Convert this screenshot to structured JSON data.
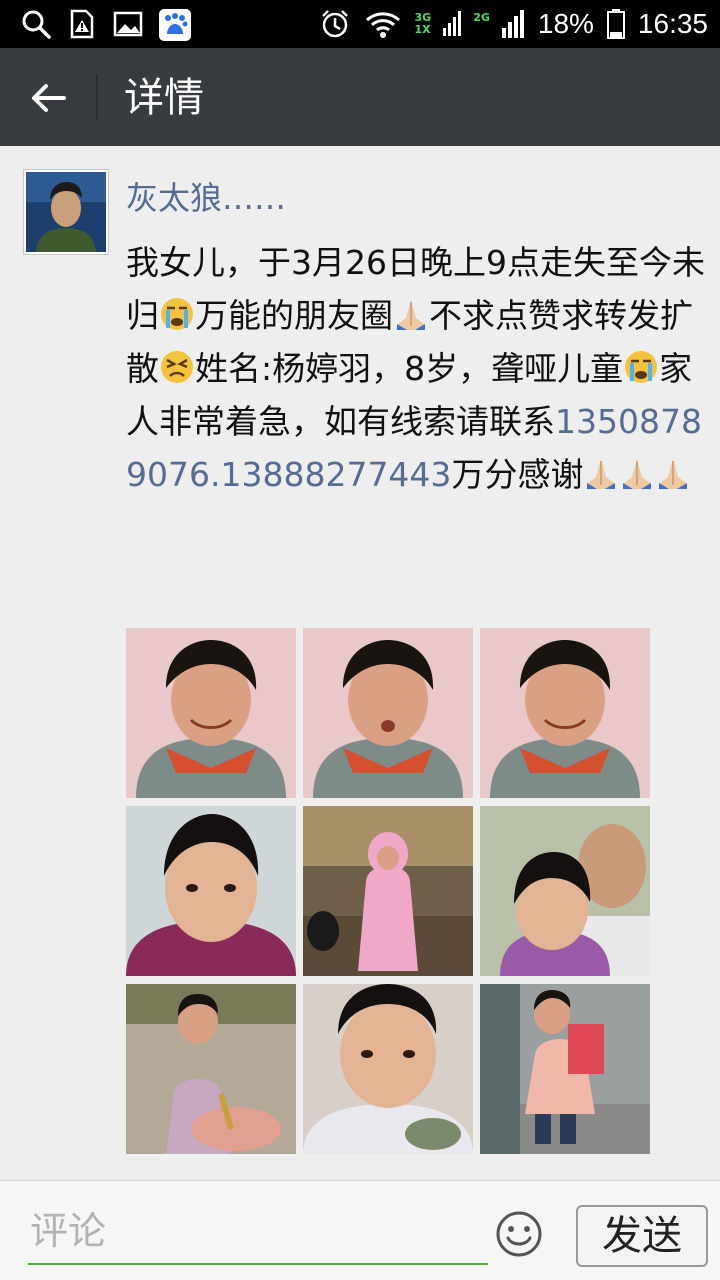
{
  "status_bar": {
    "net_top": "3G",
    "net_bottom": "1X",
    "net2": "2G",
    "battery": "18%",
    "time": "16:35"
  },
  "app_bar": {
    "title": "详情"
  },
  "post": {
    "username": "灰太狼……",
    "text_1": "我女儿，于3月26日晚上9点走失至今未归",
    "text_2": "万能的朋友圈",
    "text_3": "不求点赞求转发扩散",
    "text_4": "姓名:杨婷羽，8岁，聋哑儿童",
    "text_5": "家人非常着急，如有线索请联系",
    "phone": "13508789076.13888277443",
    "text_6": "万分感谢",
    "photo_count": 9
  },
  "comment_bar": {
    "placeholder": "评论",
    "send_label": "发送"
  },
  "colors": {
    "app_bar": "#383b3f",
    "link": "#576b95",
    "accent_green": "#4cb336"
  }
}
